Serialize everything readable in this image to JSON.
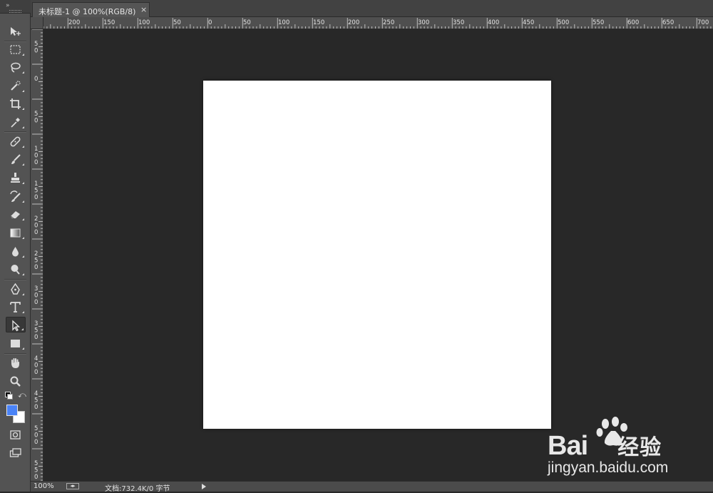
{
  "document_tab": {
    "title": "未标题-1 @ 100%(RGB/8)",
    "close": "×"
  },
  "toolbar": {
    "collapse": "»",
    "tools": [
      {
        "name": "move-tool",
        "icon": "move-icon"
      },
      {
        "name": "marquee-tool",
        "icon": "rect-marquee-icon"
      },
      {
        "name": "lasso-tool",
        "icon": "lasso-icon"
      },
      {
        "name": "quick-select-tool",
        "icon": "quick-select-icon"
      },
      {
        "name": "crop-tool",
        "icon": "crop-icon"
      },
      {
        "name": "eyedropper-tool",
        "icon": "eyedropper-icon"
      },
      {
        "name": "healing-brush-tool",
        "icon": "bandage-icon"
      },
      {
        "name": "brush-tool",
        "icon": "brush-icon"
      },
      {
        "name": "clone-stamp-tool",
        "icon": "stamp-icon"
      },
      {
        "name": "history-brush-tool",
        "icon": "history-brush-icon"
      },
      {
        "name": "eraser-tool",
        "icon": "eraser-icon"
      },
      {
        "name": "gradient-tool",
        "icon": "gradient-icon"
      },
      {
        "name": "blur-tool",
        "icon": "drop-icon"
      },
      {
        "name": "dodge-tool",
        "icon": "dodge-icon"
      },
      {
        "name": "pen-tool",
        "icon": "pen-icon"
      },
      {
        "name": "type-tool",
        "icon": "type-icon"
      },
      {
        "name": "path-select-tool",
        "icon": "arrow-select-icon",
        "active": true
      },
      {
        "name": "rectangle-tool",
        "icon": "rectangle-icon"
      },
      {
        "name": "hand-tool",
        "icon": "hand-icon"
      },
      {
        "name": "zoom-tool",
        "icon": "magnifier-icon"
      }
    ],
    "foreground_color": "#4a83f7",
    "background_color": "#ffffff"
  },
  "rulers": {
    "horizontal_labels": [
      "200",
      "150",
      "100",
      "50",
      "0",
      "50",
      "100",
      "150",
      "200",
      "250",
      "300",
      "350",
      "400",
      "450",
      "500",
      "550",
      "600",
      "650",
      "700"
    ],
    "vertical_labels": [
      "50",
      "0",
      "50",
      "100",
      "150",
      "200",
      "250",
      "300",
      "350",
      "400",
      "450",
      "500",
      "550"
    ]
  },
  "status_bar": {
    "zoom": "100%",
    "doc_info": "文档:732.4K/0 字节"
  },
  "watermark": {
    "brand": "Bai",
    "brand_suffix": "经验",
    "url": "jingyan.baidu.com"
  }
}
